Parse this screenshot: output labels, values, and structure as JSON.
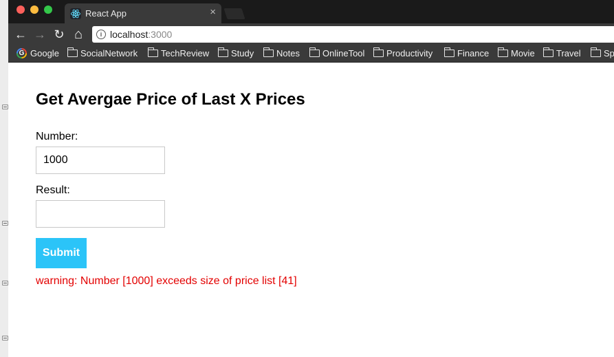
{
  "browser": {
    "tab_title": "React App",
    "tab_close": "×",
    "url_host": "localhost",
    "url_port": ":3000",
    "nav": {
      "back": "←",
      "forward": "→",
      "reload": "↻",
      "home": "⌂",
      "info": "i"
    },
    "bookmarks": [
      "Google",
      "SocialNetwork",
      "TechReview",
      "Study",
      "Notes",
      "OnlineTool",
      "Productivity",
      "Finance",
      "Movie",
      "Travel",
      "Sp"
    ],
    "traffic_colors": [
      "#fc605b",
      "#fdbc40",
      "#34c84a"
    ]
  },
  "page": {
    "heading": "Get Avergae Price of Last X Prices",
    "number_label": "Number:",
    "number_value": "1000",
    "result_label": "Result:",
    "result_value": "",
    "submit_label": "Submit",
    "warning": "warning: Number [1000] exceeds size of price list [41]",
    "accent_color": "#2bc4f8",
    "warning_color": "#e30000"
  }
}
